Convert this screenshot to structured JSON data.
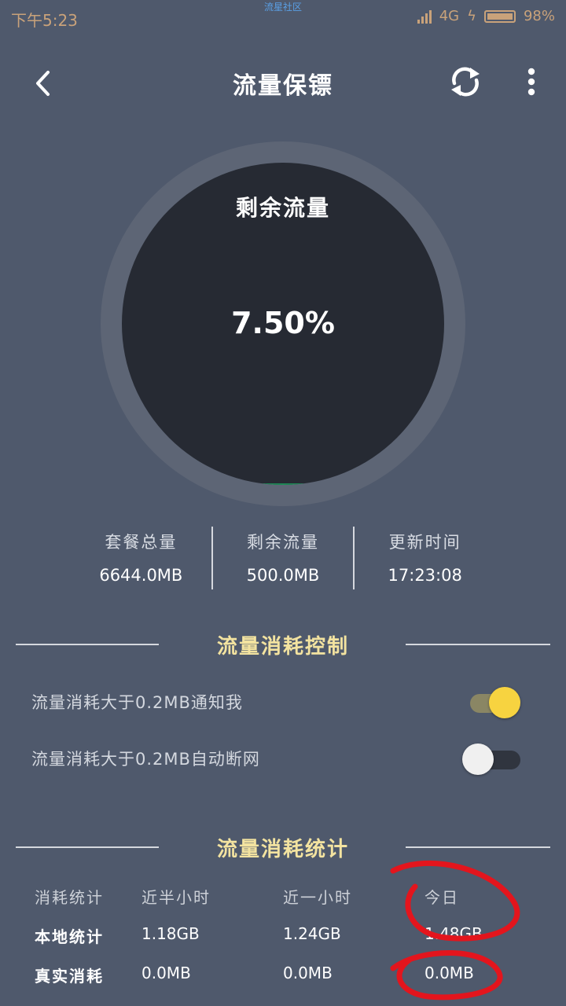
{
  "status_bar": {
    "time": "下午5:23",
    "center_text": "流星社区",
    "network": "4G",
    "battery": "98%"
  },
  "header": {
    "title": "流量保镖"
  },
  "gauge": {
    "label": "剩余流量",
    "value": "7.50%",
    "fill_fraction": 0.075,
    "fill_color": "#1e8a57"
  },
  "summary": [
    {
      "label": "套餐总量",
      "value": "6644.0MB"
    },
    {
      "label": "剩余流量",
      "value": "500.0MB"
    },
    {
      "label": "更新时间",
      "value": "17:23:08"
    }
  ],
  "control": {
    "heading": "流量消耗控制",
    "settings": [
      {
        "label": "流量消耗大于0.2MB通知我",
        "enabled": true
      },
      {
        "label": "流量消耗大于0.2MB自动断网",
        "enabled": false
      }
    ]
  },
  "stats": {
    "heading": "流量消耗统计",
    "columns": [
      "消耗统计",
      "近半小时",
      "近一小时",
      "今日"
    ],
    "rows": [
      {
        "label": "本地统计",
        "values": [
          "1.18GB",
          "1.24GB",
          "1.48GB"
        ]
      },
      {
        "label": "真实消耗",
        "values": [
          "0.0MB",
          "0.0MB",
          "0.0MB"
        ]
      }
    ]
  },
  "colors": {
    "background": "#4f596c",
    "accent_yellow": "#f7d340",
    "heading_text": "#f3e3a0",
    "annotation_red": "#e3151d"
  },
  "icons": {
    "back": "arrow-left-icon",
    "refresh": "refresh-icon",
    "more": "more-vertical-icon"
  }
}
